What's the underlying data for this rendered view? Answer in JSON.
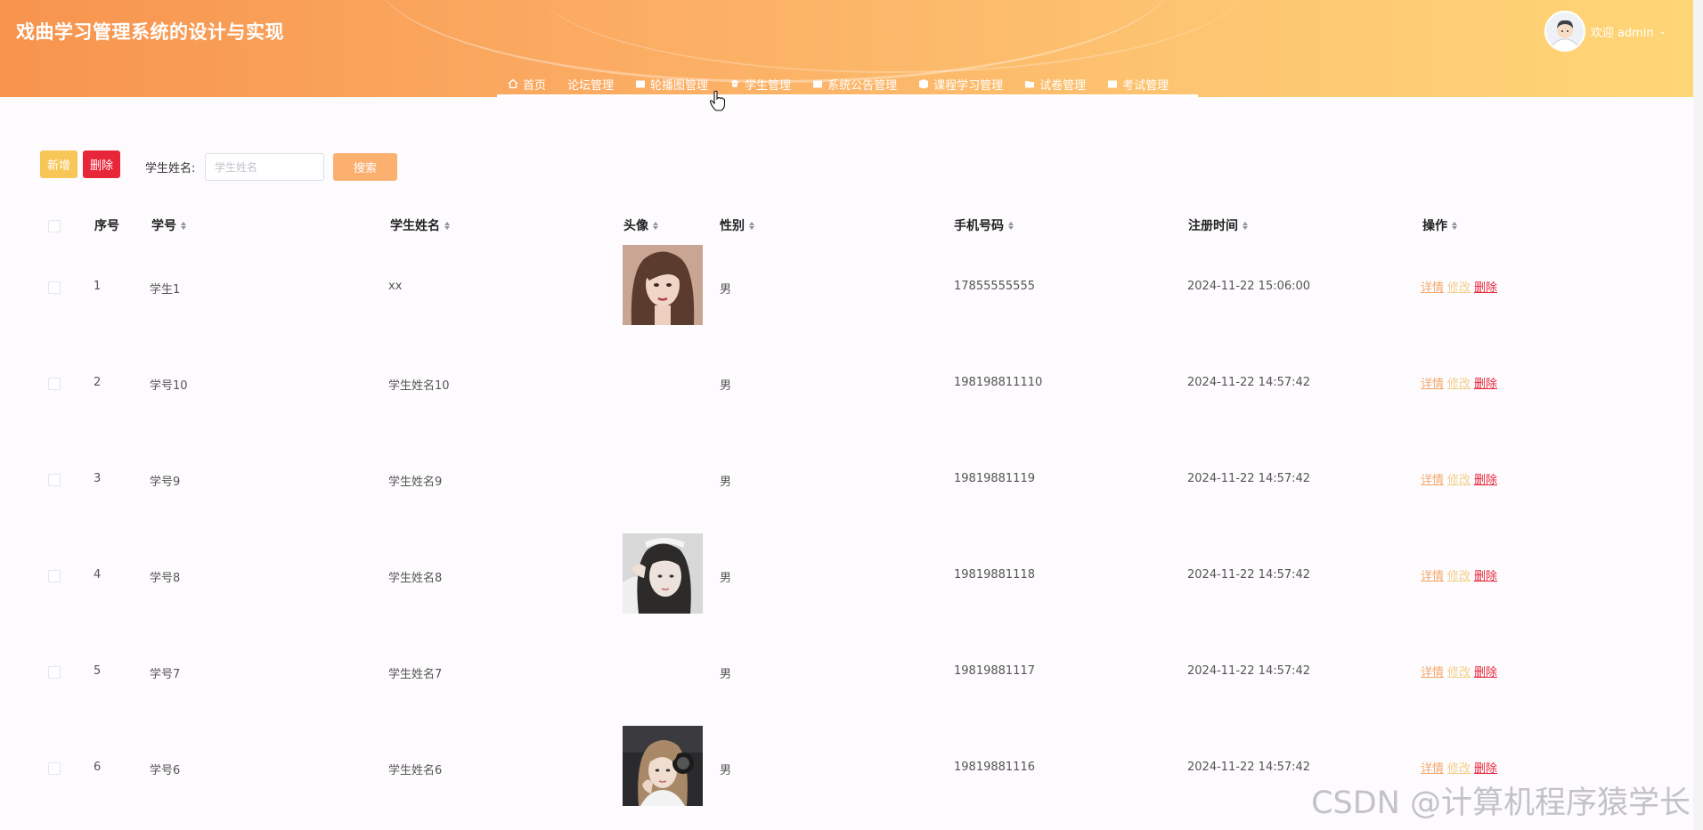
{
  "header": {
    "title": "戏曲学习管理系统的设计与实现",
    "welcome": "欢迎 admin",
    "nav": [
      {
        "label": "首页",
        "icon": "home-icon"
      },
      {
        "label": "论坛管理",
        "icon": ""
      },
      {
        "label": "轮播图管理",
        "icon": "folder-icon"
      },
      {
        "label": "学生管理",
        "icon": "user-icon"
      },
      {
        "label": "系统公告管理",
        "icon": "folder-icon"
      },
      {
        "label": "课程学习管理",
        "icon": "book-icon"
      },
      {
        "label": "试卷管理",
        "icon": "folder-icon"
      },
      {
        "label": "考试管理",
        "icon": "folder-icon"
      }
    ]
  },
  "toolbar": {
    "add_label": "新增",
    "delete_label": "删除",
    "search_label": "学生姓名:",
    "search_placeholder": "学生姓名",
    "search_value": "",
    "search_button": "搜索"
  },
  "table": {
    "columns": [
      "序号",
      "学号",
      "学生姓名",
      "头像",
      "性别",
      "手机号码",
      "注册时间",
      "操作"
    ],
    "rows": [
      {
        "index": "1",
        "student_no": "学生1",
        "name": "xx",
        "has_photo": true,
        "gender": "男",
        "phone": "17855555555",
        "registered": "2024-11-22 15:06:00"
      },
      {
        "index": "2",
        "student_no": "学号10",
        "name": "学生姓名10",
        "has_photo": false,
        "gender": "男",
        "phone": "198198811110",
        "registered": "2024-11-22 14:57:42"
      },
      {
        "index": "3",
        "student_no": "学号9",
        "name": "学生姓名9",
        "has_photo": false,
        "gender": "男",
        "phone": "19819881119",
        "registered": "2024-11-22 14:57:42"
      },
      {
        "index": "4",
        "student_no": "学号8",
        "name": "学生姓名8",
        "has_photo": true,
        "gender": "男",
        "phone": "19819881118",
        "registered": "2024-11-22 14:57:42"
      },
      {
        "index": "5",
        "student_no": "学号7",
        "name": "学生姓名7",
        "has_photo": false,
        "gender": "男",
        "phone": "19819881117",
        "registered": "2024-11-22 14:57:42"
      },
      {
        "index": "6",
        "student_no": "学号6",
        "name": "学生姓名6",
        "has_photo": true,
        "gender": "男",
        "phone": "19819881116",
        "registered": "2024-11-22 14:57:42"
      }
    ],
    "ops": {
      "detail": "详情",
      "edit": "修改",
      "delete": "删除"
    }
  },
  "watermark": "CSDN @计算机程序猿学长",
  "colors": {
    "header_start": "#f7944e",
    "header_end": "#fed676",
    "add_button": "#f8c557",
    "delete_button": "#e8263a",
    "search_button": "#fbb070"
  }
}
